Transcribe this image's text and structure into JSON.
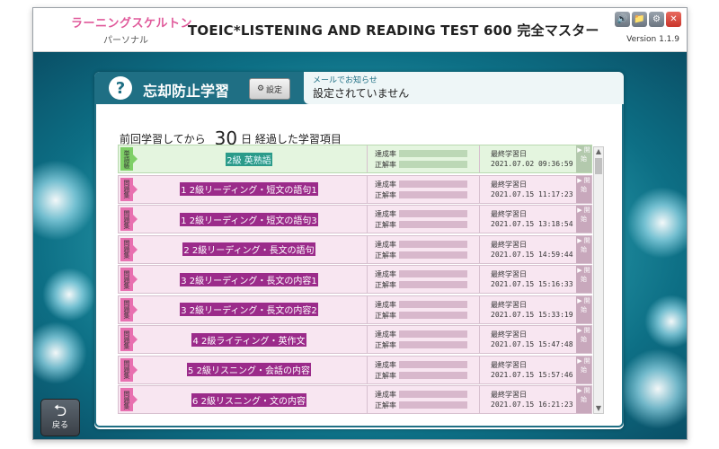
{
  "app": {
    "logo_main": "ラーニングスケルトン",
    "logo_sub": "パーソナル",
    "title": "TOEIC*LISTENING AND READING TEST 600 完全マスター",
    "version": "Version 1.1.9",
    "window_buttons": {
      "sound": "🔊",
      "folder": "📁",
      "gear": "⚙",
      "close": "✕"
    }
  },
  "panel": {
    "icon": "?",
    "title": "忘却防止学習",
    "settings_label": "設定",
    "notice_label": "メールでお知らせ",
    "notice_text": "設定されていません",
    "since_prefix": "前回学習してから",
    "since_days": "30",
    "since_suffix": "日 経過した学習項目"
  },
  "labels": {
    "rate_achieve": "達成率",
    "rate_correct": "正解率",
    "last_date": "最終学習日",
    "go": "▶ 開始"
  },
  "rows": [
    {
      "tag": "単語帳",
      "name": "2級 英熟語",
      "date": "2021.07.02 09:36:59"
    },
    {
      "tag": "問題集",
      "name": "1 2級リーディング・短文の語句1",
      "date": "2021.07.15 11:17:23"
    },
    {
      "tag": "問題集",
      "name": "1 2級リーディング・短文の語句3",
      "date": "2021.07.15 13:18:54"
    },
    {
      "tag": "問題集",
      "name": "2 2級リーディング・長文の語句",
      "date": "2021.07.15 14:59:44"
    },
    {
      "tag": "問題集",
      "name": "3 2級リーディング・長文の内容1",
      "date": "2021.07.15 15:16:33"
    },
    {
      "tag": "問題集",
      "name": "3 2級リーディング・長文の内容2",
      "date": "2021.07.15 15:33:19"
    },
    {
      "tag": "問題集",
      "name": "4 2級ライティング・英作文",
      "date": "2021.07.15 15:47:48"
    },
    {
      "tag": "問題集",
      "name": "5 2級リスニング・会話の内容",
      "date": "2021.07.15 15:57:46"
    },
    {
      "tag": "問題集",
      "name": "6 2級リスニング・文の内容",
      "date": "2021.07.15 16:21:23"
    }
  ],
  "back_button": {
    "icon": "⮌",
    "label": "戻る"
  },
  "colors": {
    "accent": "#1f6f84",
    "row_pink": "#f8e6f1",
    "row_green": "#e4f5df"
  }
}
